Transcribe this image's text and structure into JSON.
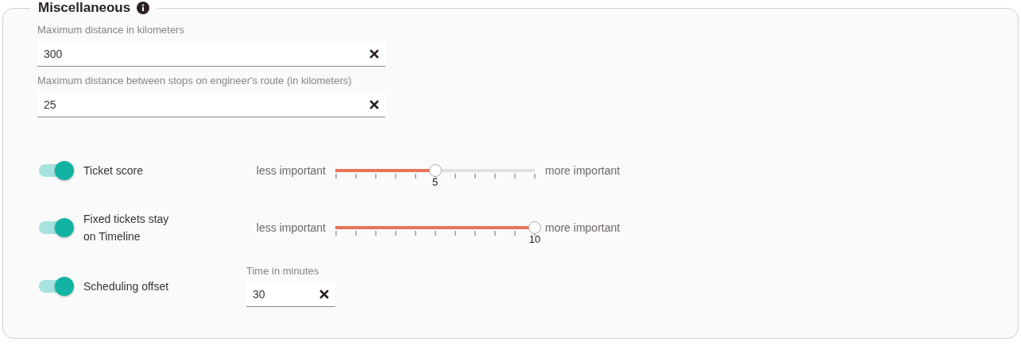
{
  "section": {
    "title": "Miscellaneous"
  },
  "fields": [
    {
      "label": "Maximum distance in kilometers",
      "value": "300"
    },
    {
      "label": "Maximum distance between stops on engineer's route (in kilometers)",
      "value": "25"
    }
  ],
  "settings": [
    {
      "kind": "slider",
      "label": "Ticket score",
      "on": true,
      "min_label": "less important",
      "max_label": "more important",
      "level": 0.5,
      "reading": "5"
    },
    {
      "kind": "slider",
      "label": "Fixed tickets stay on Timeline",
      "on": true,
      "min_label": "less important",
      "max_label": "more important",
      "level": 1,
      "reading": "10"
    },
    {
      "kind": "number",
      "label": "Scheduling offset",
      "on": true,
      "field": {
        "label": "Time in minutes",
        "value": "30"
      }
    }
  ]
}
